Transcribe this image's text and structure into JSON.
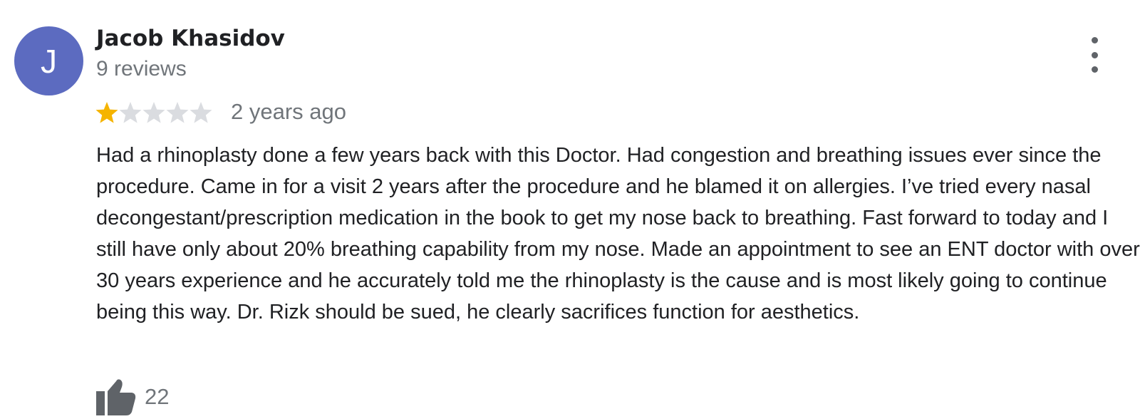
{
  "review": {
    "author": {
      "initial": "J",
      "name": "Jacob Khasidov",
      "reviews": "9 reviews",
      "avatar_color": "#5c6bc0"
    },
    "rating": 1,
    "rating_max": 5,
    "star_filled_color": "#f5b400",
    "star_empty_color": "#dadce0",
    "time": "2 years ago",
    "text": "Had a rhinoplasty done a few years back with this Doctor. Had congestion and breathing issues ever since the procedure. Came in for a visit 2 years after the procedure and he blamed it on allergies. I’ve tried every nasal decongestant/prescription medication in the book to get my nose back to breathing. Fast forward to today and I still have only about 20% breathing capability from my nose. Made an appointment to see an ENT doctor with over 30 years experience and he accurately told me the rhinoplasty is the cause and is most likely going to continue being this way. Dr. Rizk should be sued, he clearly sacrifices function for aesthetics.",
    "likes": "22",
    "icons": {
      "more": "more-vert-icon",
      "like": "thumb-up-icon",
      "star": "star-icon"
    }
  }
}
